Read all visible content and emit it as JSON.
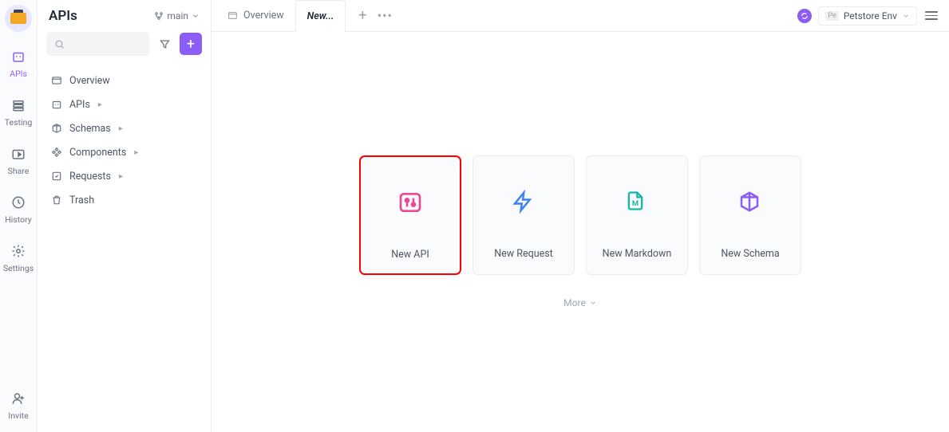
{
  "rail": {
    "items": [
      {
        "label": "APIs",
        "icon": "apis-icon"
      },
      {
        "label": "Testing",
        "icon": "testing-icon"
      },
      {
        "label": "Share",
        "icon": "share-icon"
      },
      {
        "label": "History",
        "icon": "history-icon"
      },
      {
        "label": "Settings",
        "icon": "settings-icon"
      }
    ],
    "invite_label": "Invite"
  },
  "sidebar": {
    "title": "APIs",
    "branch_label": "main",
    "search_placeholder": "",
    "items": [
      {
        "label": "Overview",
        "expandable": false
      },
      {
        "label": "APIs",
        "expandable": true
      },
      {
        "label": "Schemas",
        "expandable": true
      },
      {
        "label": "Components",
        "expandable": true
      },
      {
        "label": "Requests",
        "expandable": true
      },
      {
        "label": "Trash",
        "expandable": false
      }
    ]
  },
  "tabs": {
    "overview_label": "Overview",
    "new_label": "New..."
  },
  "env": {
    "badge": "Pe",
    "selected_label": "Petstore Env"
  },
  "cards": [
    {
      "label": "New API",
      "highlighted": true
    },
    {
      "label": "New Request",
      "highlighted": false
    },
    {
      "label": "New Markdown",
      "highlighted": false
    },
    {
      "label": "New Schema",
      "highlighted": false
    }
  ],
  "more_label": "More"
}
